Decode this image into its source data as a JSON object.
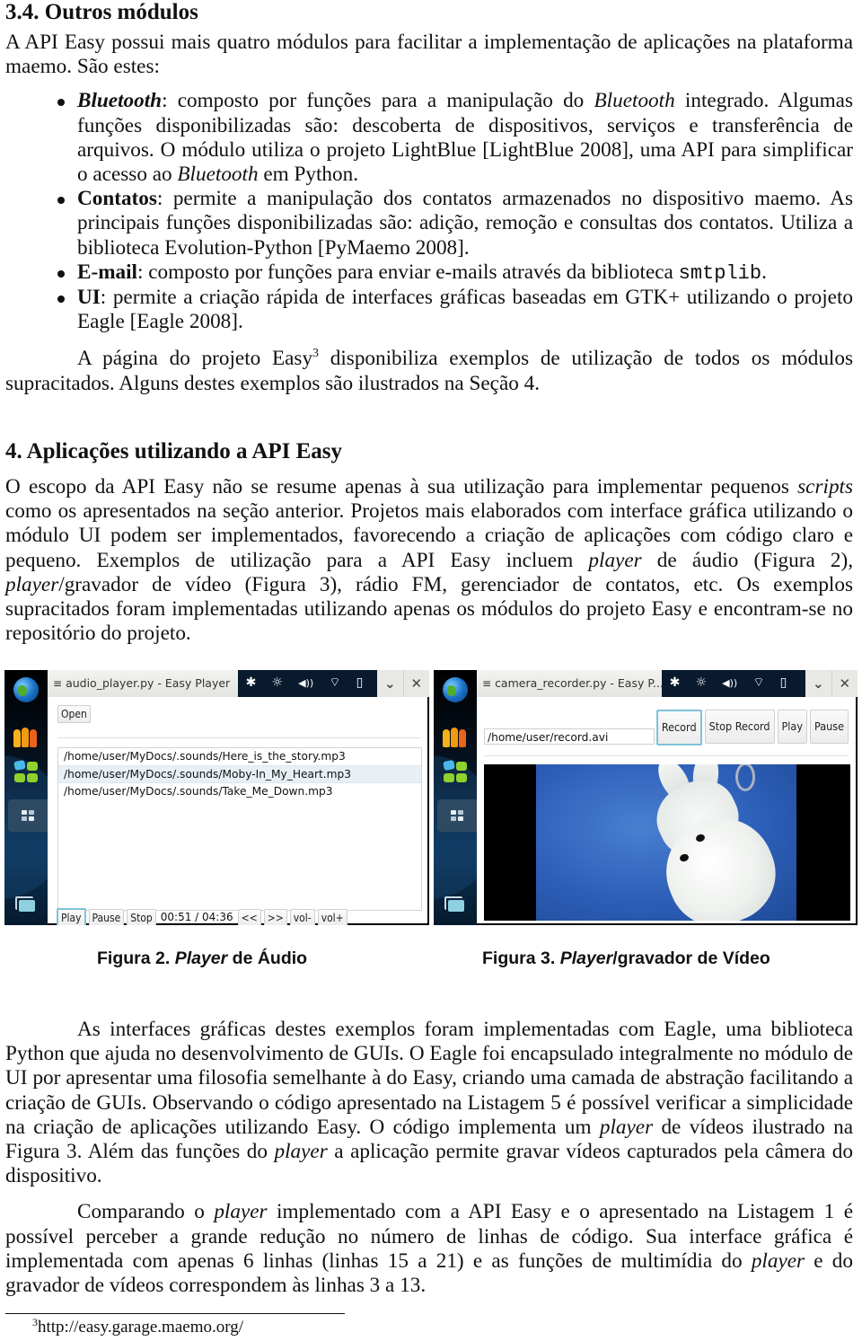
{
  "section_3_4": {
    "heading": "3.4. Outros módulos",
    "intro": "A API Easy possui mais quatro módulos para facilitar a implementação de aplicações na plataforma maemo. São estes:",
    "bullets": [
      {
        "term": "Bluetooth",
        "text_a": ": composto por funções para a manipulação do ",
        "em": "Bluetooth",
        "text_b": " integrado. Algumas funções disponibilizadas são: descoberta de dispositivos, serviços e transferência de arquivos. O módulo utiliza o projeto LightBlue [LightBlue 2008], uma API para simplificar o acesso ao ",
        "em2": "Bluetooth",
        "text_c": " em Python."
      },
      {
        "term": "Contatos",
        "text": ":  permite a manipulação dos contatos armazenados no dispositivo maemo.  As principais funções disponibilizadas são: adição, remoção e consultas dos contatos. Utiliza a biblioteca Evolution-Python [PyMaemo 2008]."
      },
      {
        "term": "E-mail",
        "text": ":  composto por funções para enviar e-mails através da biblioteca ",
        "code": "smtplib",
        "tail": "."
      },
      {
        "term": "UI",
        "text": ": permite a criação rápida de interfaces gráficas baseadas em GTK+ utilizando o projeto Eagle [Eagle 2008]."
      }
    ],
    "closing_a": "A página do projeto Easy",
    "closing_sup": "3",
    "closing_b": " disponibiliza exemplos de utilização de todos os módulos supracitados. Alguns destes exemplos são ilustrados na Seção 4."
  },
  "section_4": {
    "heading": "4.  Aplicações utilizando a API Easy",
    "p1_a": "O escopo da API Easy não se resume apenas à sua utilização para implementar pequenos ",
    "p1_em1": "scripts",
    "p1_b": " como os apresentados na seção anterior.  Projetos mais elaborados com interface gráfica utilizando o módulo UI podem ser implementados, favorecendo a criação de aplicações com código claro e pequeno. Exemplos de utilização para a API Easy incluem ",
    "p1_em2": "player",
    "p1_c": " de áudio (Figura 2), ",
    "p1_em3": "player",
    "p1_d": "/gravador de vídeo (Figura 3), rádio FM, gerenciador de contatos, etc.  Os exemplos supracitados foram implementadas utilizando apenas os módulos do projeto Easy e encontram-se no repositório do projeto."
  },
  "figure2": {
    "window_title": "audio_player.py - Easy Player",
    "open_button": "Open",
    "files": [
      "/home/user/MyDocs/.sounds/Here_is_the_story.mp3",
      "/home/user/MyDocs/.sounds/Moby-In_My_Heart.mp3",
      "/home/user/MyDocs/.sounds/Take_Me_Down.mp3"
    ],
    "selected_index": 1,
    "controls": {
      "play": "Play",
      "pause": "Pause",
      "stop": "Stop",
      "time": "00:51 / 04:36",
      "rewind": "<<",
      "forward": ">>",
      "vol_down": "vol-",
      "vol_up": "vol+"
    },
    "caption_prefix": "Figura 2. ",
    "caption_em": "Player",
    "caption_suffix": " de Áudio"
  },
  "figure3": {
    "window_title": "camera_recorder.py - Easy P...",
    "path_value": "/home/user/record.avi",
    "buttons": {
      "record": "Record",
      "stop_record": "Stop Record",
      "play": "Play",
      "pause": "Pause"
    },
    "caption_prefix": "Figura 3. ",
    "caption_em": "Player",
    "caption_suffix": "/gravador de Vídeo"
  },
  "status_icons": {
    "menu": "≡",
    "bluetooth": "✱",
    "brightness": "☼",
    "volume": "◀))",
    "wifi": "⌔",
    "battery": "▯",
    "minimize": "⌄",
    "close": "✕"
  },
  "paragraph_eagle": {
    "a": "As interfaces gráficas destes exemplos foram implementadas com Eagle, uma biblioteca Python que ajuda no desenvolvimento de GUIs.  O Eagle foi encapsulado integralmente no módulo de UI por apresentar uma filosofia semelhante à do Easy, criando uma camada de abstração facilitando a criação de GUIs.  Observando o código apresentado na Listagem 5 é possível verificar a simplicidade na criação de aplicações utilizando Easy. O código implementa um ",
    "em1": "player",
    "b": " de vídeos ilustrado na Figura 3. Além das funções do ",
    "em2": "player",
    "c": " a aplicação permite gravar vídeos capturados pela câmera do dispositivo."
  },
  "paragraph_compare": {
    "a": "Comparando o ",
    "em1": "player",
    "b": " implementado com a API Easy e o apresentado na Listagem 1 é possível perceber a grande redução no número de linhas de código.  Sua interface gráfica é implementada com apenas 6 linhas (linhas 15 a 21) e as funções de multimídia do ",
    "em2": "player",
    "c": " e do gravador de vídeos correspondem às linhas 3 a 13."
  },
  "footnote": {
    "mark": "3",
    "url": "http://easy.garage.maemo.org/"
  }
}
